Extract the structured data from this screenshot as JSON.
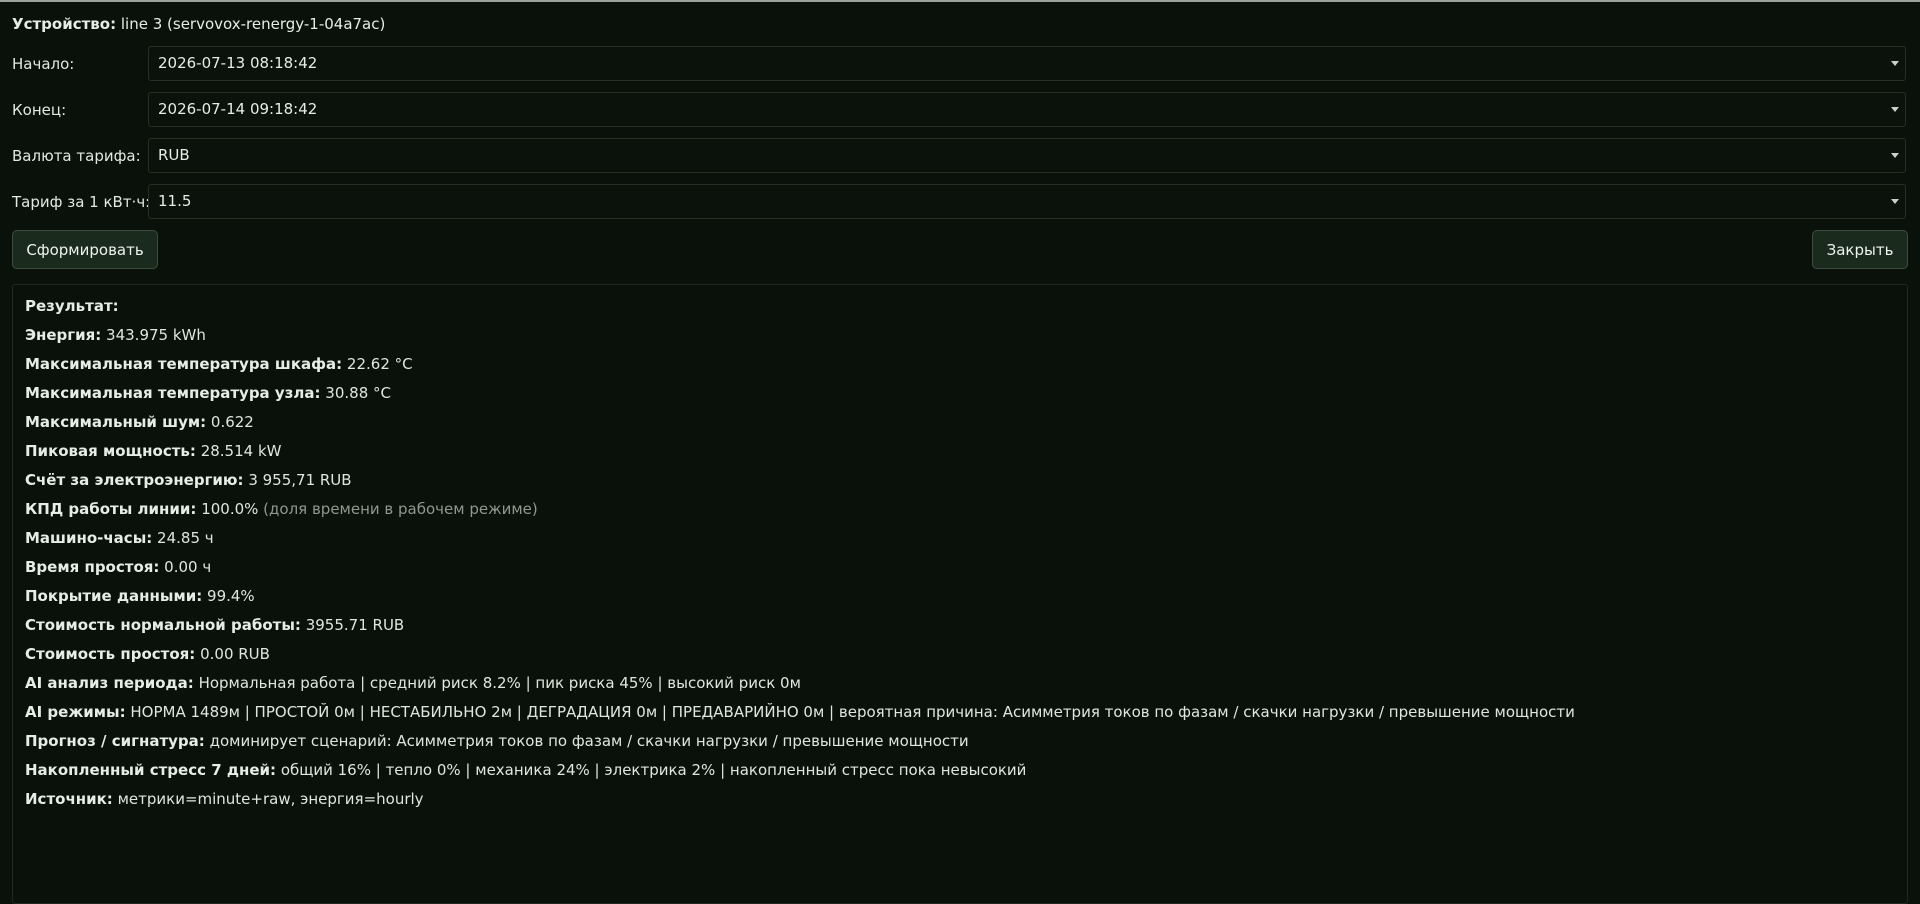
{
  "device": {
    "label": "Устройство:",
    "value": "line 3 (servovox-renergy-1-04a7ac)"
  },
  "form": {
    "start": {
      "label": "Начало:",
      "value": "2026-07-13 08:18:42"
    },
    "end": {
      "label": "Конец:",
      "value": "2026-07-14 09:18:42"
    },
    "currency": {
      "label": "Валюта тарифа:",
      "value": "RUB"
    },
    "tariff": {
      "label": "Тариф за 1 кВт·ч:",
      "value": "11.5"
    }
  },
  "buttons": {
    "generate": "Сформировать",
    "close": "Закрыть"
  },
  "result": {
    "title": "Результат:",
    "lines": [
      {
        "k": "Энергия:",
        "v": "343.975 kWh"
      },
      {
        "k": "Максимальная температура шкафа:",
        "v": "22.62 °C"
      },
      {
        "k": "Максимальная температура узла:",
        "v": "30.88 °C"
      },
      {
        "k": "Максимальный шум:",
        "v": "0.622"
      },
      {
        "k": "Пиковая мощность:",
        "v": "28.514 kW"
      },
      {
        "k": "Счёт за электроэнергию:",
        "v": "3 955,71 RUB"
      },
      {
        "k": "КПД работы линии:",
        "v": "100.0%",
        "note": "(доля времени в рабочем режиме)"
      },
      {
        "k": "Машино-часы:",
        "v": "24.85 ч"
      },
      {
        "k": "Время простоя:",
        "v": "0.00 ч"
      },
      {
        "k": "Покрытие данными:",
        "v": "99.4%"
      },
      {
        "k": "Стоимость нормальной работы:",
        "v": "3955.71 RUB"
      },
      {
        "k": "Стоимость простоя:",
        "v": "0.00 RUB"
      },
      {
        "k": "AI анализ периода:",
        "v": "Нормальная работа | средний риск 8.2% | пик риска 45% | высокий риск 0м"
      },
      {
        "k": "AI режимы:",
        "v": "НОРМА 1489м | ПРОСТОЙ 0м | НЕСТАБИЛЬНО 2м | ДЕГРАДАЦИЯ 0м | ПРЕДАВАРИЙНО 0м | вероятная причина: Асимметрия токов по фазам / скачки нагрузки / превышение мощности"
      },
      {
        "k": "Прогноз / сигнатура:",
        "v": "доминирует сценарий: Асимметрия токов по фазам / скачки нагрузки / превышение мощности"
      },
      {
        "k": "Накопленный стресс 7 дней:",
        "v": "общий 16% | тепло 0% | механика 24% | электрика 2% | накопленный стресс пока невысокий"
      },
      {
        "k": "Источник:",
        "v": "метрики=minute+raw, энергия=hourly"
      }
    ]
  }
}
